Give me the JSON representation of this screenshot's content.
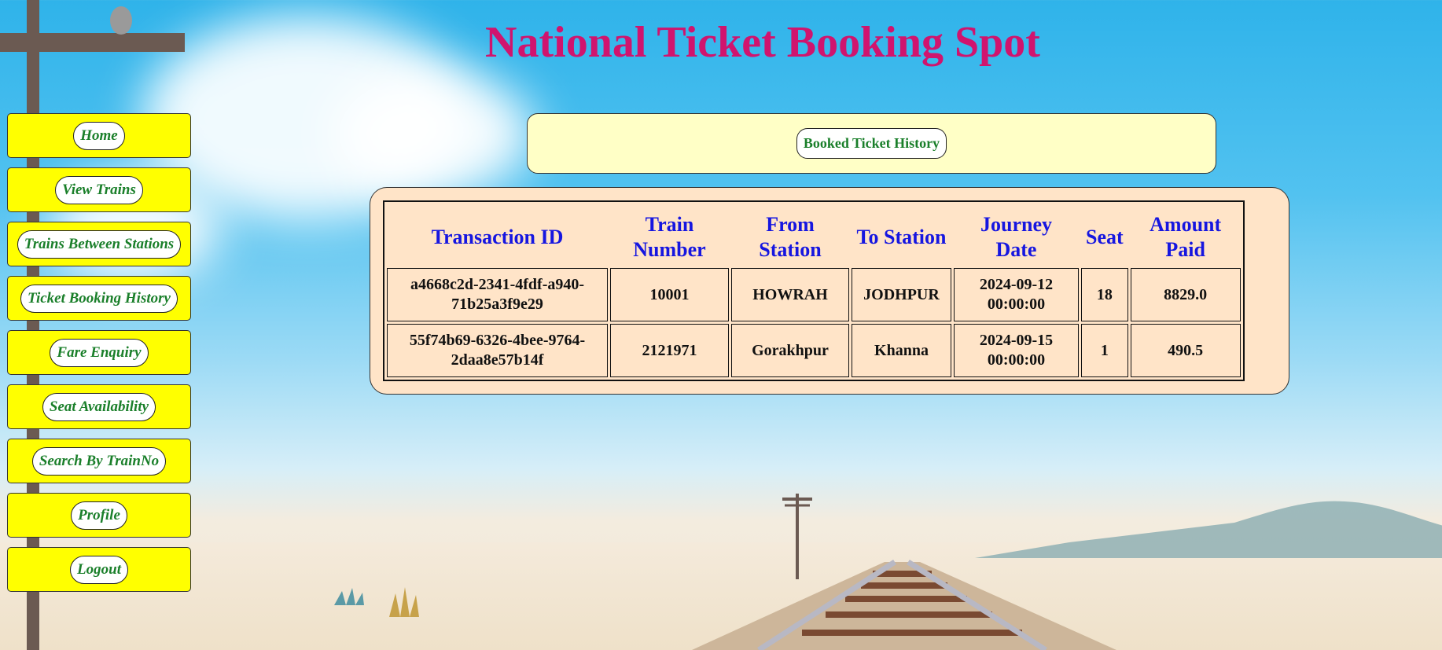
{
  "title": "National Ticket Booking Spot",
  "sidebar": {
    "items": [
      {
        "label": "Home"
      },
      {
        "label": "View Trains"
      },
      {
        "label": "Trains Between Stations"
      },
      {
        "label": "Ticket Booking History"
      },
      {
        "label": "Fare Enquiry"
      },
      {
        "label": "Seat Availability"
      },
      {
        "label": "Search By TrainNo"
      },
      {
        "label": "Profile"
      },
      {
        "label": "Logout"
      }
    ]
  },
  "panel": {
    "button_label": "Booked Ticket History"
  },
  "table": {
    "headers": [
      "Transaction ID",
      "Train Number",
      "From Station",
      "To Station",
      "Journey Date",
      "Seat",
      "Amount Paid"
    ],
    "rows": [
      [
        "a4668c2d-2341-4fdf-a940-71b25a3f9e29",
        "10001",
        "HOWRAH",
        "JODHPUR",
        "2024-09-12 00:00:00",
        "18",
        "8829.0"
      ],
      [
        "55f74b69-6326-4bee-9764-2daa8e57b14f",
        "2121971",
        "Gorakhpur",
        "Khanna",
        "2024-09-15 00:00:00",
        "1",
        "490.5"
      ]
    ]
  },
  "colors": {
    "title": "#d0146e",
    "nav_background": "#ffff00",
    "nav_text": "#1a7f2a",
    "table_header_text": "#1616e0",
    "table_panel": "#ffe4c8",
    "history_panel": "#ffffc6"
  }
}
